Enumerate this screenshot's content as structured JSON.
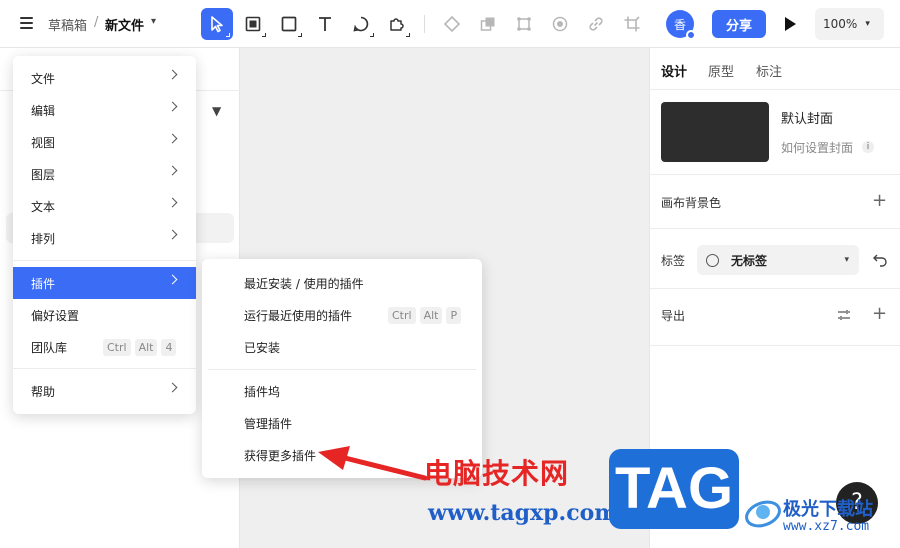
{
  "header": {
    "breadcrumb_folder": "草稿箱",
    "breadcrumb_separator": "/",
    "file_name": "新文件",
    "avatar_text": "香",
    "share_label": "分享",
    "zoom_value": "100%"
  },
  "toolbar": {
    "tools": [
      "move-tool",
      "frame-tool",
      "rectangle-tool",
      "text-tool",
      "pen-tool",
      "plugin-tool"
    ],
    "disabled_tools": [
      "component-tool",
      "boolean-tool",
      "mask-tool",
      "fill-tool",
      "link-tool",
      "crop-tool"
    ]
  },
  "main_menu": {
    "items": [
      {
        "label": "文件",
        "has_submenu": true
      },
      {
        "label": "编辑",
        "has_submenu": true
      },
      {
        "label": "视图",
        "has_submenu": true
      },
      {
        "label": "图层",
        "has_submenu": true
      },
      {
        "label": "文本",
        "has_submenu": true
      },
      {
        "label": "排列",
        "has_submenu": true
      },
      {
        "label": "插件",
        "has_submenu": true,
        "active": true
      },
      {
        "label": "偏好设置",
        "has_submenu": false
      },
      {
        "label": "团队库",
        "has_submenu": false,
        "shortcut": [
          "Ctrl",
          "Alt",
          "4"
        ]
      },
      {
        "label": "帮助",
        "has_submenu": true
      }
    ]
  },
  "plugin_submenu": {
    "items": [
      {
        "label": "最近安装 / 使用的插件"
      },
      {
        "label": "运行最近使用的插件",
        "shortcut": [
          "Ctrl",
          "Alt",
          "P"
        ]
      },
      {
        "label": "已安装"
      },
      {
        "label": "插件坞"
      },
      {
        "label": "管理插件"
      },
      {
        "label": "获得更多插件"
      }
    ]
  },
  "right_panel": {
    "tabs": [
      "设计",
      "原型",
      "标注"
    ],
    "active_tab": "设计",
    "cover_title": "默认封面",
    "cover_help": "如何设置封面",
    "canvas_bg_label": "画布背景色",
    "tags_label": "标签",
    "tags_value": "无标签",
    "export_label": "导出"
  },
  "watermark": {
    "cn_text": "电脑技术网",
    "url_text": "www.tagxp.com",
    "tag_text": "TAG",
    "help_text": "?",
    "site_name": "极光下载站",
    "site_url": "www.xz7.com"
  },
  "colors": {
    "accent": "#3b6cf6",
    "arrow": "#e62525",
    "watermark_blue": "#1f6fd8"
  }
}
